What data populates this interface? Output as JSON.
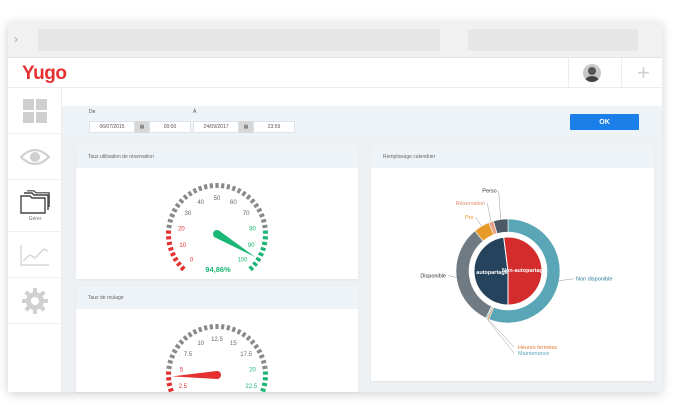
{
  "app": {
    "logo": "Yugo"
  },
  "header": {
    "avatar": "avatar",
    "add_icon": "plus-icon"
  },
  "sidebar": {
    "items": [
      {
        "icon": "grid-icon",
        "label": ""
      },
      {
        "icon": "eye-icon",
        "label": ""
      },
      {
        "icon": "folders-icon",
        "label": "Gérer"
      },
      {
        "icon": "line-chart-icon",
        "label": ""
      },
      {
        "icon": "gear-icon",
        "label": ""
      }
    ]
  },
  "filter": {
    "from_label": "De",
    "from_date": "06/07/2015",
    "from_time": "00:00",
    "to_label": "À",
    "to_date": "24/09/2017",
    "to_time": "23:59",
    "ok_label": "OK"
  },
  "cards": {
    "usage": {
      "title": "Taux utilisation de réservation"
    },
    "rolling": {
      "title": "Taux de roulage"
    },
    "calendar": {
      "title": "Remplissage calendrier"
    }
  },
  "chart_data": [
    {
      "type": "gauge",
      "title": "Taux utilisation de réservation",
      "min": 0,
      "max": 100,
      "tick_labels": [
        "0",
        "10",
        "20",
        "30",
        "40",
        "50",
        "60",
        "70",
        "80",
        "90",
        "100"
      ],
      "value": 94.86,
      "value_label": "94,86%",
      "colors": {
        "low": "#e53030",
        "high": "#1bb673",
        "mid": "#8a8a8a"
      }
    },
    {
      "type": "gauge",
      "title": "Taux de roulage",
      "min": 0,
      "max": 25,
      "tick_labels": [
        "0",
        "2.5",
        "5",
        "7.5",
        "10",
        "12.5",
        "15",
        "17.5",
        "20",
        "22.5",
        "25"
      ],
      "value": 4,
      "value_label": "",
      "colors": {
        "low": "#e53030",
        "high": "#1bb673",
        "mid": "#8a8a8a"
      }
    },
    {
      "type": "pie",
      "title": "Remplissage calendrier",
      "inner": [
        {
          "name": "autopartage",
          "value": 48,
          "color": "#25435d"
        },
        {
          "name": "Non-autopartage",
          "value": 52,
          "color": "#d42c2c"
        }
      ],
      "outer": [
        {
          "name": "Non disponible",
          "value": 56,
          "color": "#5aa6b6",
          "label_color": "#2d7e9a"
        },
        {
          "name": "Heures fermées",
          "value": 0.5,
          "color": "#e07b39",
          "label_color": "#e07b39"
        },
        {
          "name": "Maintenance",
          "value": 0.5,
          "color": "#7ec6c9",
          "label_color": "#5aa6b6"
        },
        {
          "name": "Disponible",
          "value": 32,
          "color": "#707a82",
          "label_color": "#333333"
        },
        {
          "name": "Pro",
          "value": 5,
          "color": "#e59a2a",
          "label_color": "#e59a2a"
        },
        {
          "name": "Réservation",
          "value": 1.5,
          "color": "#e8a48a",
          "label_color": "#e08a6a"
        },
        {
          "name": "Perso",
          "value": 4.5,
          "color": "#4b5a66",
          "label_color": "#333333"
        }
      ]
    }
  ]
}
